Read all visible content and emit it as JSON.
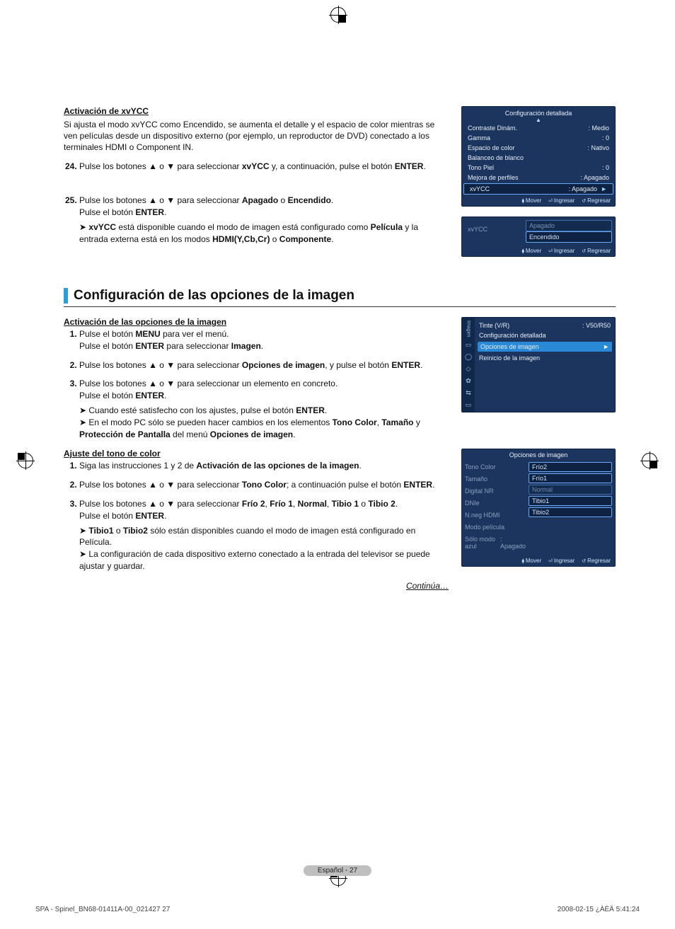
{
  "section_xvycc": {
    "heading": "Activación de xvYCC",
    "intro": "Si ajusta el modo xvYCC como Encendido, se aumenta el detalle y el espacio de color mientras se ven películas desde un dispositivo externo (por ejemplo, un reproductor de DVD) conectado a los terminales HDMI o Component IN.",
    "step24": {
      "num": "24",
      "t1": "Pulse los botones ▲ o ▼ para seleccionar ",
      "b1": "xvYCC",
      "t2": " y, a continuación, pulse el botón ",
      "b2": "ENTER",
      "t3": "."
    },
    "step25": {
      "num": "25",
      "t1": "Pulse los botones ▲ o ▼ para seleccionar ",
      "b1": "Apagado",
      "t2": " o ",
      "b2": "Encendido",
      "t3": ".",
      "line2a": "Pulse el botón ",
      "line2b": "ENTER",
      "line2c": ".",
      "note_a": "xvYCC",
      "note_b": " está disponible cuando el modo de imagen está configurado como ",
      "note_c": "Película",
      "note_d": " y la entrada externa está en los modos ",
      "note_e": "HDMI(Y,Cb,Cr)",
      "note_f": " o ",
      "note_g": "Componente",
      "note_h": "."
    }
  },
  "osd1": {
    "title": "Configuración detallada",
    "rows": [
      {
        "l": "Contraste Dinám.",
        "v": ": Medio"
      },
      {
        "l": "Gamma",
        "v": ": 0"
      },
      {
        "l": "Espacio de color",
        "v": ": Nativo"
      },
      {
        "l": "Balanceo de blanco",
        "v": ""
      },
      {
        "l": "Tono Piel",
        "v": ": 0"
      },
      {
        "l": "Mejora de perfiles",
        "v": ": Apagado"
      }
    ],
    "sel": {
      "l": "xvYCC",
      "v": ": Apagado",
      "play": "►"
    },
    "footer": {
      "move": "Mover",
      "enter": "Ingresar",
      "back": "Regresar"
    }
  },
  "osd2": {
    "label": "xvYCC",
    "opt_sel": "Apagado",
    "opt_other": "Encendido",
    "footer": {
      "move": "Mover",
      "enter": "Ingresar",
      "back": "Regresar"
    }
  },
  "section_title": "Configuración de las opciones de la imagen",
  "section_activ": {
    "heading": "Activación de las opciones de la imagen",
    "steps": [
      {
        "a": "Pulse el botón ",
        "b": "MENU",
        "c": " para ver el menú.",
        "d": "Pulse el botón ",
        "e": "ENTER",
        "f": " para seleccionar ",
        "g": "Imagen",
        "h": "."
      },
      {
        "a": "Pulse los botones ▲ o ▼ para seleccionar ",
        "b": "Opciones de imagen",
        "c": ", y pulse el botón ",
        "d": "ENTER",
        "e": "."
      },
      {
        "a": "Pulse los botones ▲ o ▼ para seleccionar un elemento en concreto.",
        "b": "Pulse el botón ",
        "c": "ENTER",
        "d": ".",
        "notes": [
          {
            "a": "Cuando esté satisfecho con los ajustes, pulse el botón ",
            "b": "ENTER",
            "c": "."
          },
          {
            "a": "En el modo PC sólo se pueden hacer cambios en los elementos ",
            "b": "Tono Color",
            "c": ", ",
            "d": "Tamaño",
            "e": " y ",
            "f": "Protección de Pantalla",
            "g": " del menú ",
            "h": "Opciones de imagen",
            "i": "."
          }
        ]
      }
    ]
  },
  "osd3": {
    "strip": "Imagen",
    "row1": {
      "l": "Tinte (V/R)",
      "v": ": V50/R50"
    },
    "row2": "Configuración detallada",
    "sel": {
      "l": "Opciones de imagen",
      "play": "►"
    },
    "row3": "Reinicio de la imagen"
  },
  "section_color": {
    "heading": "Ajuste del tono de color",
    "steps": [
      {
        "a": "Siga las instrucciones 1 y 2 de ",
        "b": "Activación de las opciones de la imagen",
        "c": "."
      },
      {
        "a": "Pulse los botones ▲ o ▼ para seleccionar ",
        "b": "Tono Color",
        "c": "; a continuación pulse el botón ",
        "d": "ENTER",
        "e": "."
      },
      {
        "a": "Pulse los botones ▲ o ▼ para seleccionar ",
        "b": "Frío 2",
        "c": ", ",
        "d": "Frío 1",
        "e": ", ",
        "f": "Normal",
        "g": ", ",
        "h": "Tibio 1",
        "i": " o ",
        "j": "Tibio 2",
        "k": ".",
        "l": "Pulse el botón ",
        "m": "ENTER",
        "n": ".",
        "notes": [
          {
            "a": "Tibio1",
            "b": " o ",
            "c": "Tibio2",
            "d": " sólo están disponibles cuando el modo de imagen está configurado en Película."
          },
          {
            "a": "La configuración de cada dispositivo externo conectado a la entrada del televisor se puede ajustar y guardar."
          }
        ]
      }
    ]
  },
  "osd4": {
    "title": "Opciones de imagen",
    "labels": [
      "Tono Color",
      "Tamaño",
      "Digital NR",
      "DNIe",
      "N.neg HDMI",
      "Modo película",
      "Sólo modo azul"
    ],
    "values": [
      "Frío2",
      "Frío1",
      "Normal",
      "Tibio1",
      "Tibio2"
    ],
    "last": {
      "v": ": Apagado"
    },
    "footer": {
      "move": "Mover",
      "enter": "Ingresar",
      "back": "Regresar"
    }
  },
  "continua": "Continúa…",
  "footer_pill": "Español - 27",
  "doc_code": "SPA - Spinel_BN68-01411A-00_021427   27",
  "doc_time": "2008-02-15   ¿ÀÈÄ 5:41:24"
}
